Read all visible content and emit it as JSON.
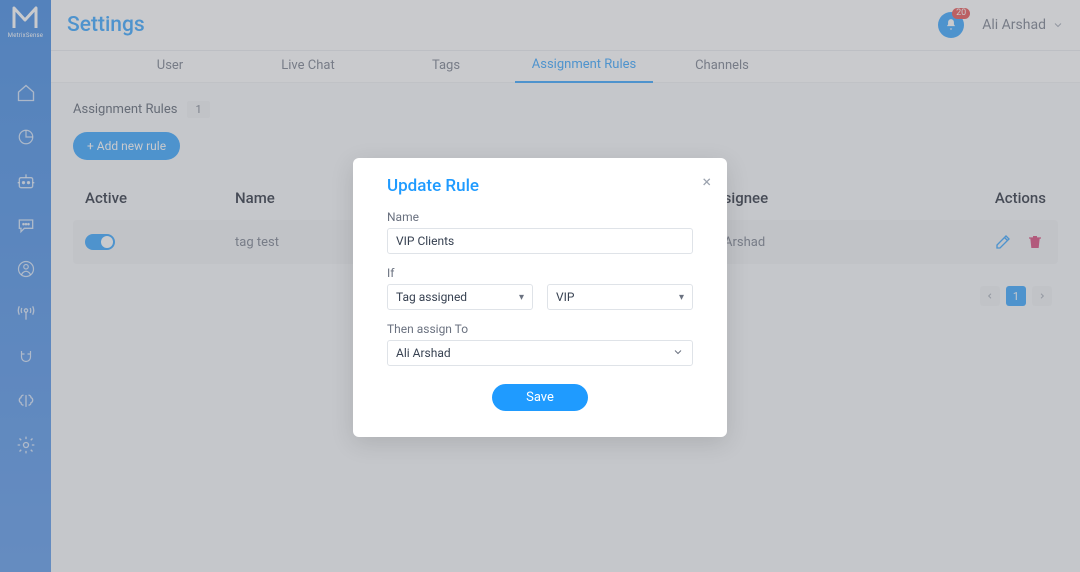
{
  "brand": {
    "name": "MetrixSense"
  },
  "header": {
    "title": "Settings",
    "notification_count": "20",
    "user_name": "Ali Arshad"
  },
  "tabs": [
    {
      "label": "User"
    },
    {
      "label": "Live Chat"
    },
    {
      "label": "Tags"
    },
    {
      "label": "Assignment Rules"
    },
    {
      "label": "Channels"
    }
  ],
  "active_tab_index": 3,
  "subheader": {
    "title": "Assignment Rules",
    "count": "1",
    "add_button": "+ Add new rule"
  },
  "table": {
    "columns": {
      "active": "Active",
      "name": "Name",
      "assignee": "Assignee",
      "actions": "Actions"
    },
    "rows": [
      {
        "active": true,
        "name": "tag test",
        "assignee": "Ali Arshad"
      }
    ]
  },
  "pagination": {
    "current": "1"
  },
  "modal": {
    "title": "Update Rule",
    "name_label": "Name",
    "name_value": "VIP Clients",
    "if_label": "If",
    "condition_type": "Tag assigned",
    "condition_value": "VIP",
    "assign_label": "Then assign To",
    "assign_value": "Ali Arshad",
    "save_label": "Save"
  }
}
